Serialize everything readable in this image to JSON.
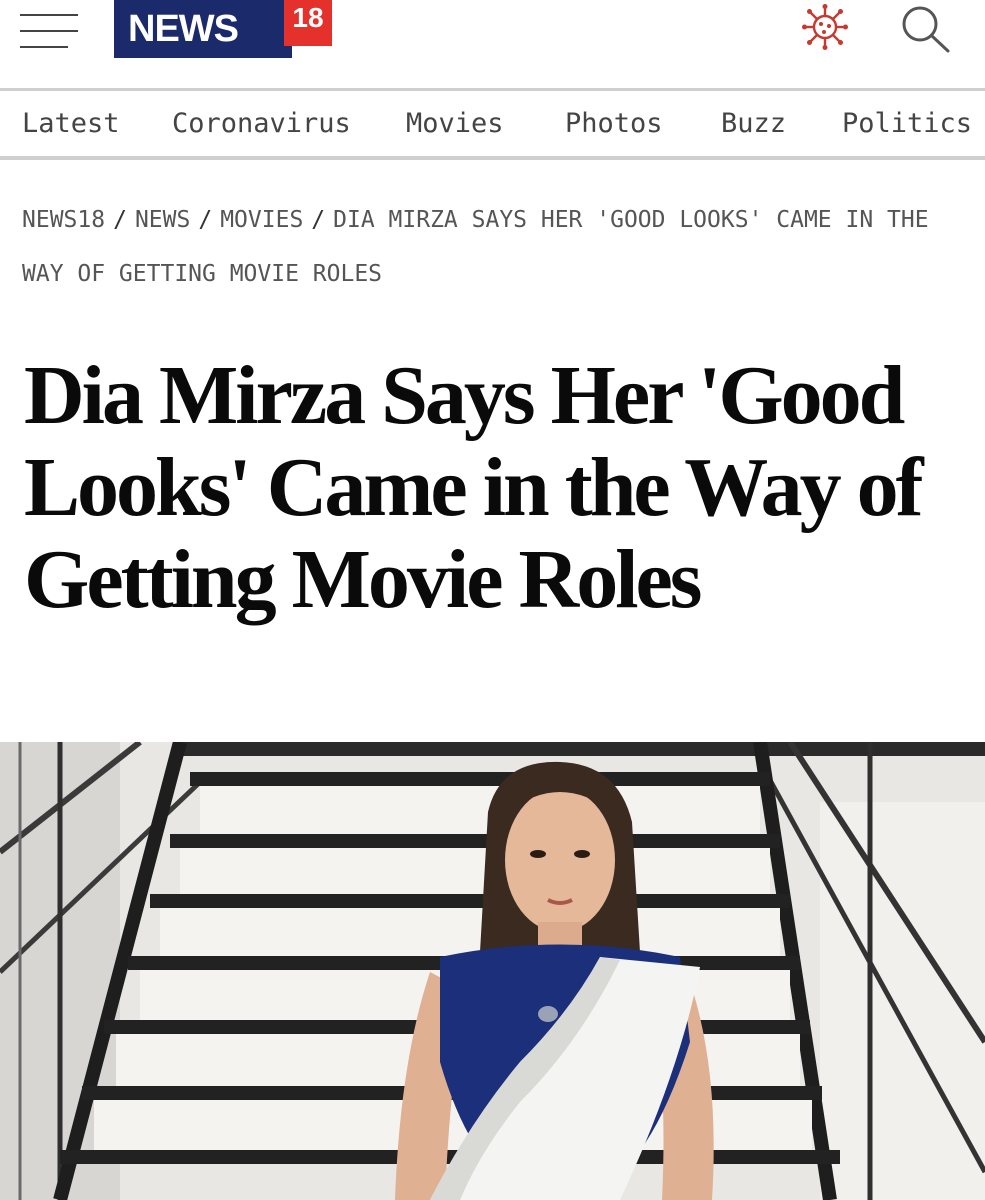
{
  "header": {
    "logo_text": "NEWS",
    "logo_badge": "18",
    "menu_icon": "hamburger-menu-icon",
    "corona_icon": "coronavirus-icon",
    "search_icon": "search-icon",
    "brand_blue": "#1b2a6b",
    "brand_red": "#e4312b"
  },
  "nav": {
    "items": [
      {
        "label": "Latest"
      },
      {
        "label": "Coronavirus"
      },
      {
        "label": "Movies"
      },
      {
        "label": "Photos"
      },
      {
        "label": "Buzz"
      },
      {
        "label": "Politics"
      }
    ]
  },
  "breadcrumb": {
    "items": [
      {
        "label": "NEWS18"
      },
      {
        "label": "NEWS"
      },
      {
        "label": "MOVIES"
      },
      {
        "label": "DIA MIRZA SAYS HER 'GOOD LOOKS' CAME IN THE WAY OF GETTING MOVIE ROLES"
      }
    ],
    "separator": "/"
  },
  "article": {
    "headline": "Dia Mirza Says Her 'Good Looks' Came in the Way of Getting Movie Roles",
    "hero_image": "photo of woman in white saree and blue blouse standing in front of black staircase"
  }
}
